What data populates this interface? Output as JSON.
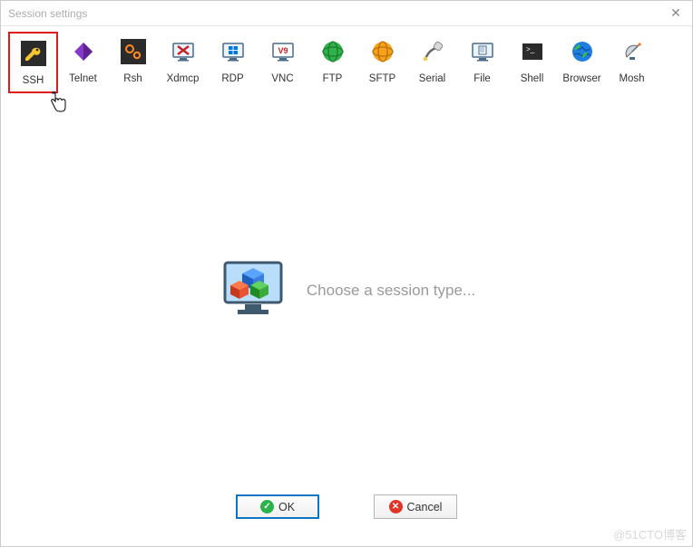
{
  "window": {
    "title": "Session settings"
  },
  "sessions": [
    {
      "label": "SSH"
    },
    {
      "label": "Telnet"
    },
    {
      "label": "Rsh"
    },
    {
      "label": "Xdmcp"
    },
    {
      "label": "RDP"
    },
    {
      "label": "VNC"
    },
    {
      "label": "FTP"
    },
    {
      "label": "SFTP"
    },
    {
      "label": "Serial"
    },
    {
      "label": "File"
    },
    {
      "label": "Shell"
    },
    {
      "label": "Browser"
    },
    {
      "label": "Mosh"
    }
  ],
  "content": {
    "placeholder": "Choose a session type..."
  },
  "footer": {
    "ok": "OK",
    "cancel": "Cancel"
  },
  "watermark": "@51CTO博客"
}
